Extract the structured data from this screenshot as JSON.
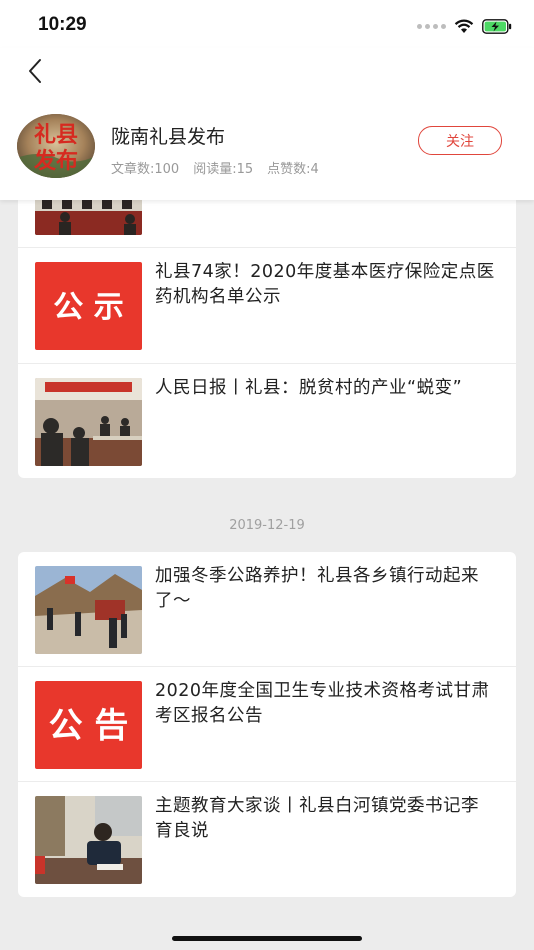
{
  "status_bar": {
    "time": "10:29"
  },
  "publisher": {
    "name": "陇南礼县发布",
    "avatar_text": [
      "礼县",
      "发布"
    ],
    "stats": [
      "文章数:100",
      "阅读量:15",
      "点赞数:4"
    ],
    "follow_label": "关注"
  },
  "group1": {
    "items": [
      {
        "title": "礼县74家！2020年度基本医疗保险定点医药机构名单公示",
        "thumb": "notice-gongshi",
        "thumb_text": "公 示"
      },
      {
        "title": "人民日报丨礼县：脱贫村的产业“蜕变”",
        "thumb": "meeting-photo"
      }
    ]
  },
  "group2": {
    "date": "2019-12-19",
    "items": [
      {
        "title": "加强冬季公路养护！礼县各乡镇行动起来了～",
        "thumb": "road-photo"
      },
      {
        "title": "2020年度全国卫生专业技术资格考试甘肃考区报名公告",
        "thumb": "notice-gonggao",
        "thumb_text": "公 告"
      },
      {
        "title": "主题教育大家谈丨礼县白河镇党委书记李育良说",
        "thumb": "office-photo"
      }
    ]
  },
  "colors": {
    "accent": "#e0463c",
    "notice_red": "#e8372c"
  }
}
